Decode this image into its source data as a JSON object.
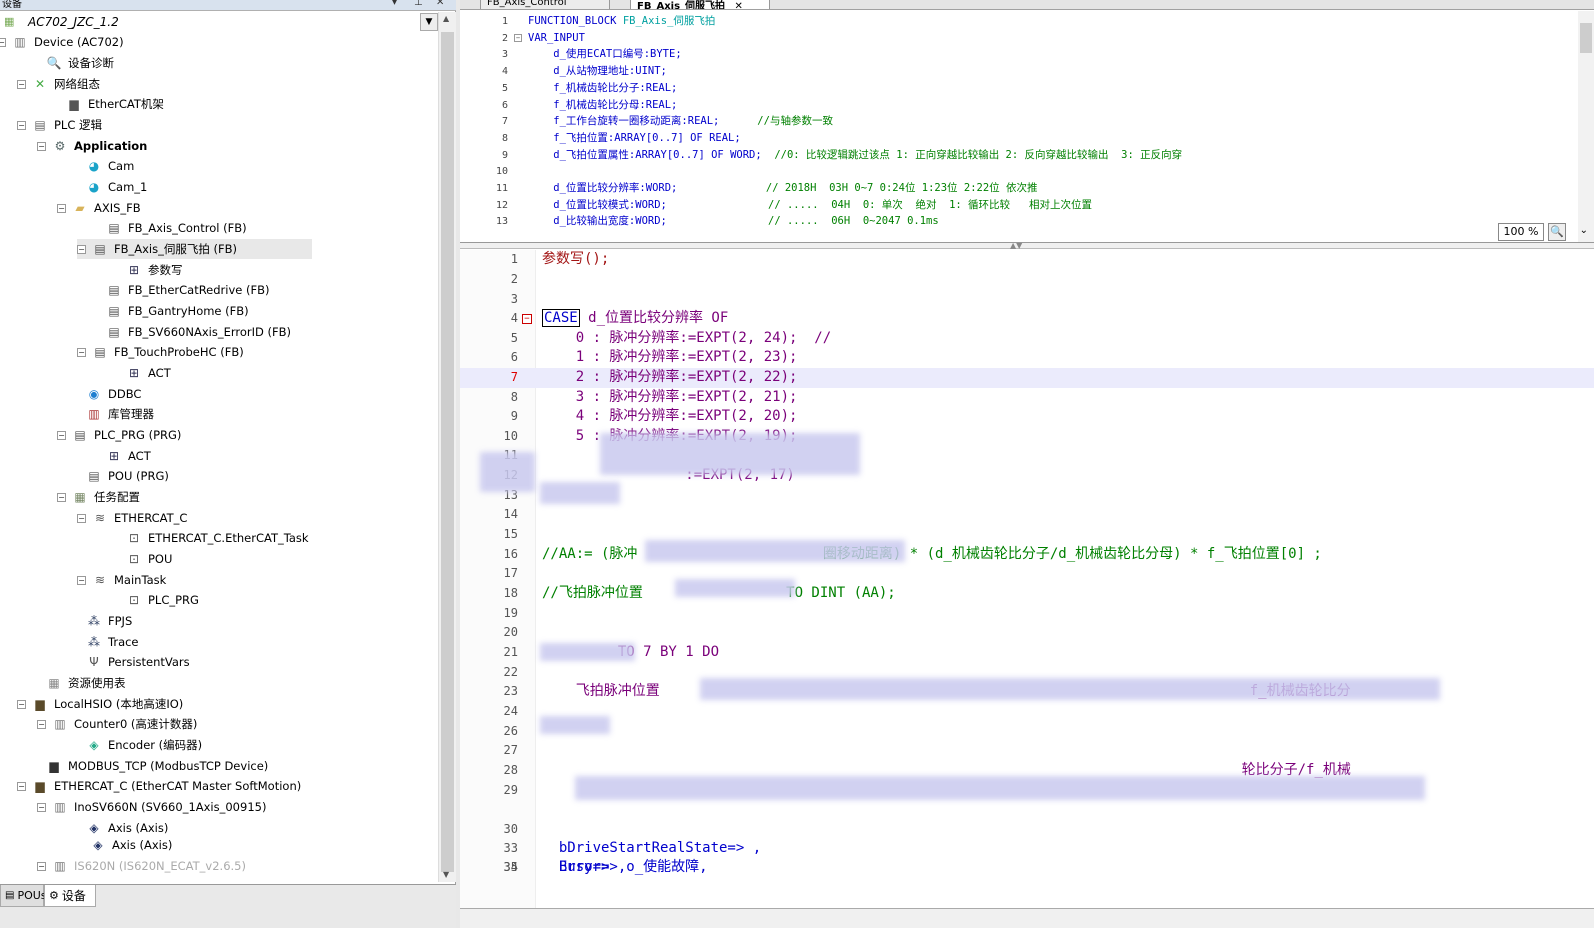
{
  "left": {
    "title": "设备",
    "project": "AC702_JZC_1.2",
    "tree": [
      {
        "label": "Device (AC702)",
        "icon": "device-icon"
      },
      {
        "label": "设备诊断",
        "icon": "diagnosis-icon"
      },
      {
        "label": "网络组态",
        "icon": "network-config-icon"
      },
      {
        "label": "EtherCAT机架",
        "icon": "ethercat-rack-icon"
      },
      {
        "label": "PLC 逻辑",
        "icon": "plc-logic-icon"
      },
      {
        "label": "Application",
        "icon": "application-gear-icon"
      },
      {
        "label": "Cam",
        "icon": "cam-icon"
      },
      {
        "label": "Cam_1",
        "icon": "cam-icon"
      },
      {
        "label": "AXIS_FB",
        "icon": "folder-icon"
      },
      {
        "label": "FB_Axis_Control (FB)",
        "icon": "function-block-icon"
      },
      {
        "label": "FB_Axis_伺服飞拍 (FB)",
        "icon": "function-block-icon"
      },
      {
        "label": "参数写",
        "icon": "action-icon"
      },
      {
        "label": "FB_EtherCatRedrive (FB)",
        "icon": "function-block-icon"
      },
      {
        "label": "FB_GantryHome (FB)",
        "icon": "function-block-icon"
      },
      {
        "label": "FB_SV660NAxis_ErrorID (FB)",
        "icon": "function-block-icon"
      },
      {
        "label": "FB_TouchProbeHC (FB)",
        "icon": "function-block-icon"
      },
      {
        "label": "ACT",
        "icon": "action-icon"
      },
      {
        "label": "DDBC",
        "icon": "globe-icon"
      },
      {
        "label": "库管理器",
        "icon": "library-icon"
      },
      {
        "label": "PLC_PRG (PRG)",
        "icon": "program-icon"
      },
      {
        "label": "ACT",
        "icon": "action-icon"
      },
      {
        "label": "POU (PRG)",
        "icon": "program-icon"
      },
      {
        "label": "任务配置",
        "icon": "task-config-icon"
      },
      {
        "label": "ETHERCAT_C",
        "icon": "task-icon"
      },
      {
        "label": "ETHERCAT_C.EtherCAT_Task",
        "icon": "task-call-icon"
      },
      {
        "label": "POU",
        "icon": "task-call-icon"
      },
      {
        "label": "MainTask",
        "icon": "task-icon"
      },
      {
        "label": "PLC_PRG",
        "icon": "task-call-icon"
      },
      {
        "label": "FPJS",
        "icon": "trace-icon"
      },
      {
        "label": "Trace",
        "icon": "trace-icon"
      },
      {
        "label": "PersistentVars",
        "icon": "persistent-vars-icon"
      },
      {
        "label": "资源使用表",
        "icon": "resource-table-icon"
      },
      {
        "label": "LocalHSIO (本地高速IO)",
        "icon": "hsio-icon"
      },
      {
        "label": "Counter0 (高速计数器)",
        "icon": "counter-icon"
      },
      {
        "label": "Encoder (编码器)",
        "icon": "encoder-icon"
      },
      {
        "label": "MODBUS_TCP (ModbusTCP Device)",
        "icon": "modbus-icon"
      },
      {
        "label": "ETHERCAT_C (EtherCAT Master SoftMotion)",
        "icon": "ethercat-master-icon"
      },
      {
        "label": "InoSV660N (SV660_1Axis_00915)",
        "icon": "servo-drive-icon"
      },
      {
        "label": "Axis (Axis)",
        "icon": "axis-icon"
      },
      {
        "label": "Axis (Axis)",
        "icon": "axis-icon"
      },
      {
        "label": "IS620N (IS620N_ECAT_v2.6.5)",
        "icon": "servo-drive-icon"
      }
    ],
    "tabs": [
      {
        "label": "POUs"
      },
      {
        "label": "设备"
      }
    ]
  },
  "editor": {
    "tabs": [
      {
        "label": "FB_Axis_Control"
      },
      {
        "label": "FB_Axis_伺服飞拍"
      }
    ],
    "zoom": "100 %",
    "decl_lines": [
      {
        "n": "1",
        "t1": "FUNCTION_BLOCK ",
        "t2": "FB_Axis_伺服飞拍",
        "t3": ""
      },
      {
        "n": "2",
        "t1": "VAR_INPUT",
        "t2": "",
        "t3": ""
      },
      {
        "n": "3",
        "t1": "    d_使用ECAT口编号:BYTE;",
        "t2": "",
        "t3": ""
      },
      {
        "n": "4",
        "t1": "    d_从站物理地址:UINT;",
        "t2": "",
        "t3": ""
      },
      {
        "n": "5",
        "t1": "    f_机械齿轮比分子:REAL;",
        "t2": "",
        "t3": ""
      },
      {
        "n": "6",
        "t1": "    f_机械齿轮比分母:REAL;",
        "t2": "",
        "t3": ""
      },
      {
        "n": "7",
        "t1": "    f_工作台旋转一圈移动距离:REAL;      ",
        "t2": "",
        "t3": "//与轴参数一致"
      },
      {
        "n": "8",
        "t1": "    f_飞拍位置:ARRAY[0..7] OF REAL;",
        "t2": "",
        "t3": ""
      },
      {
        "n": "9",
        "t1": "    d_飞拍位置属性:ARRAY[0..7] OF WORD;  ",
        "t2": "",
        "t3": "//0: 比较逻辑跳过该点 1: 正向穿越比较输出 2: 反向穿越比较输出  3: 正反向穿"
      },
      {
        "n": "10",
        "t1": "",
        "t2": "",
        "t3": ""
      },
      {
        "n": "11",
        "t1": "    d_位置比较分辨率:WORD;              ",
        "t2": "",
        "t3": "// 2018H  03H 0~7 0:24位 1:23位 2:22位 依次推"
      },
      {
        "n": "12",
        "t1": "    d_位置比较模式:WORD;                ",
        "t2": "",
        "t3": "// .....  04H  0: 单次  绝对  1: 循环比较   相对上次位置"
      },
      {
        "n": "13",
        "t1": "    d_比较输出宽度:WORD;                ",
        "t2": "",
        "t3": "// .....  06H  0~2047 0.1ms"
      }
    ],
    "impl_lines": [
      {
        "n": "1",
        "text": "参数写();"
      },
      {
        "n": "2",
        "text": ""
      },
      {
        "n": "3",
        "text": ""
      },
      {
        "n": "4",
        "kw": "CASE",
        "text": " d_位置比较分辨率 OF"
      },
      {
        "n": "5",
        "text": "    0 : 脉冲分辨率:=EXPT(2, 24);  //"
      },
      {
        "n": "6",
        "text": "    1 : 脉冲分辨率:=EXPT(2, 23);"
      },
      {
        "n": "7",
        "text": "    2 : 脉冲分辨率:=EXPT(2, 22);"
      },
      {
        "n": "8",
        "text": "    3 : 脉冲分辨率:=EXPT(2, 21);"
      },
      {
        "n": "9",
        "text": "    4 : 脉冲分辨率:=EXPT(2, 20);"
      },
      {
        "n": "10",
        "text": "    5 : 脉冲分辨率:=EXPT(2, 19);"
      },
      {
        "n": "11",
        "text": ""
      },
      {
        "n": "12",
        "text": "                 :=EXPT(2, 17)"
      },
      {
        "n": "13",
        "text": ""
      },
      {
        "n": "14",
        "text": ""
      },
      {
        "n": "15",
        "text": ""
      },
      {
        "n": "16",
        "text": "//AA:= (脉冲                      圈移动距离) * (d_机械齿轮比分子/d_机械齿轮比分母) * f_飞拍位置[0] ;"
      },
      {
        "n": "17",
        "text": ""
      },
      {
        "n": "18",
        "text": "//飞拍脉冲位置                 TO DINT (AA);"
      },
      {
        "n": "19",
        "text": ""
      },
      {
        "n": "20",
        "text": ""
      },
      {
        "n": "21",
        "text": "         TO 7 BY 1 DO"
      },
      {
        "n": "22",
        "text": ""
      },
      {
        "n": "23",
        "text": "    飞拍脉冲位置                                                                      f_机械齿轮比分"
      },
      {
        "n": "24",
        "text": ""
      },
      {
        "n": "26",
        "text": ""
      },
      {
        "n": "27",
        "text": ""
      },
      {
        "n": "28",
        "text": "                                                                                   轮比分子/f_机械"
      },
      {
        "n": "29",
        "text": ""
      },
      {
        "n": "30",
        "text": ""
      },
      {
        "n": "33",
        "text": "  bDriveStartRealState=> ,"
      },
      {
        "n": "34",
        "text": "  Busy=> ,"
      },
      {
        "n": "35",
        "text": "  Error=> o_使能故障,"
      }
    ]
  }
}
